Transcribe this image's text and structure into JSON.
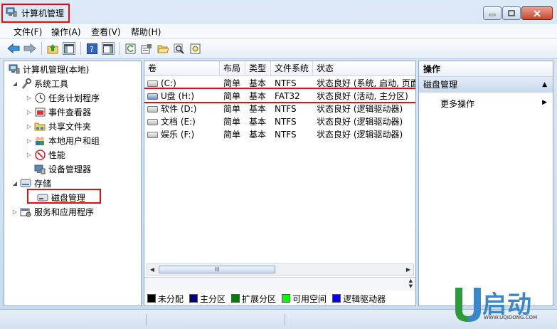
{
  "window": {
    "title": "计算机管理"
  },
  "menu": [
    "文件(F)",
    "操作(A)",
    "查看(V)",
    "帮助(H)"
  ],
  "tree": {
    "root": "计算机管理(本地)",
    "system_tools": "系统工具",
    "task_scheduler": "任务计划程序",
    "event_viewer": "事件查看器",
    "shared_folders": "共享文件夹",
    "local_users": "本地用户和组",
    "performance": "性能",
    "device_manager": "设备管理器",
    "storage": "存储",
    "disk_management": "磁盘管理",
    "services_apps": "服务和应用程序"
  },
  "table": {
    "headers": [
      "卷",
      "布局",
      "类型",
      "文件系统",
      "状态"
    ],
    "rows": [
      {
        "volume": "(C:)",
        "layout": "简单",
        "type": "基本",
        "fs": "NTFS",
        "status": "状态良好 (系统, 启动, 页面"
      },
      {
        "volume": "U盘 (H:)",
        "layout": "简单",
        "type": "基本",
        "fs": "FAT32",
        "status": "状态良好 (活动, 主分区)"
      },
      {
        "volume": "软件 (D:)",
        "layout": "简单",
        "type": "基本",
        "fs": "NTFS",
        "status": "状态良好 (逻辑驱动器)"
      },
      {
        "volume": "文档 (E:)",
        "layout": "简单",
        "type": "基本",
        "fs": "NTFS",
        "status": "状态良好 (逻辑驱动器)"
      },
      {
        "volume": "娱乐 (F:)",
        "layout": "简单",
        "type": "基本",
        "fs": "NTFS",
        "status": "状态良好 (逻辑驱动器)"
      }
    ]
  },
  "scrollbar": {
    "thumb_grip": "III"
  },
  "legend": [
    {
      "label": "未分配",
      "color": "#000000"
    },
    {
      "label": "主分区",
      "color": "#000080"
    },
    {
      "label": "扩展分区",
      "color": "#008000"
    },
    {
      "label": "可用空间",
      "color": "#00ff00"
    },
    {
      "label": "逻辑驱动器",
      "color": "#0000ff"
    }
  ],
  "actions": {
    "header": "操作",
    "section": "磁盘管理",
    "more": "更多操作"
  },
  "watermark": {
    "brand": "启动",
    "url": "WWW.UQIDONG.COM"
  },
  "colors": {
    "highlight": "#e01010",
    "logo_blue": "#3a87c9",
    "logo_green": "#2e9b3a"
  }
}
